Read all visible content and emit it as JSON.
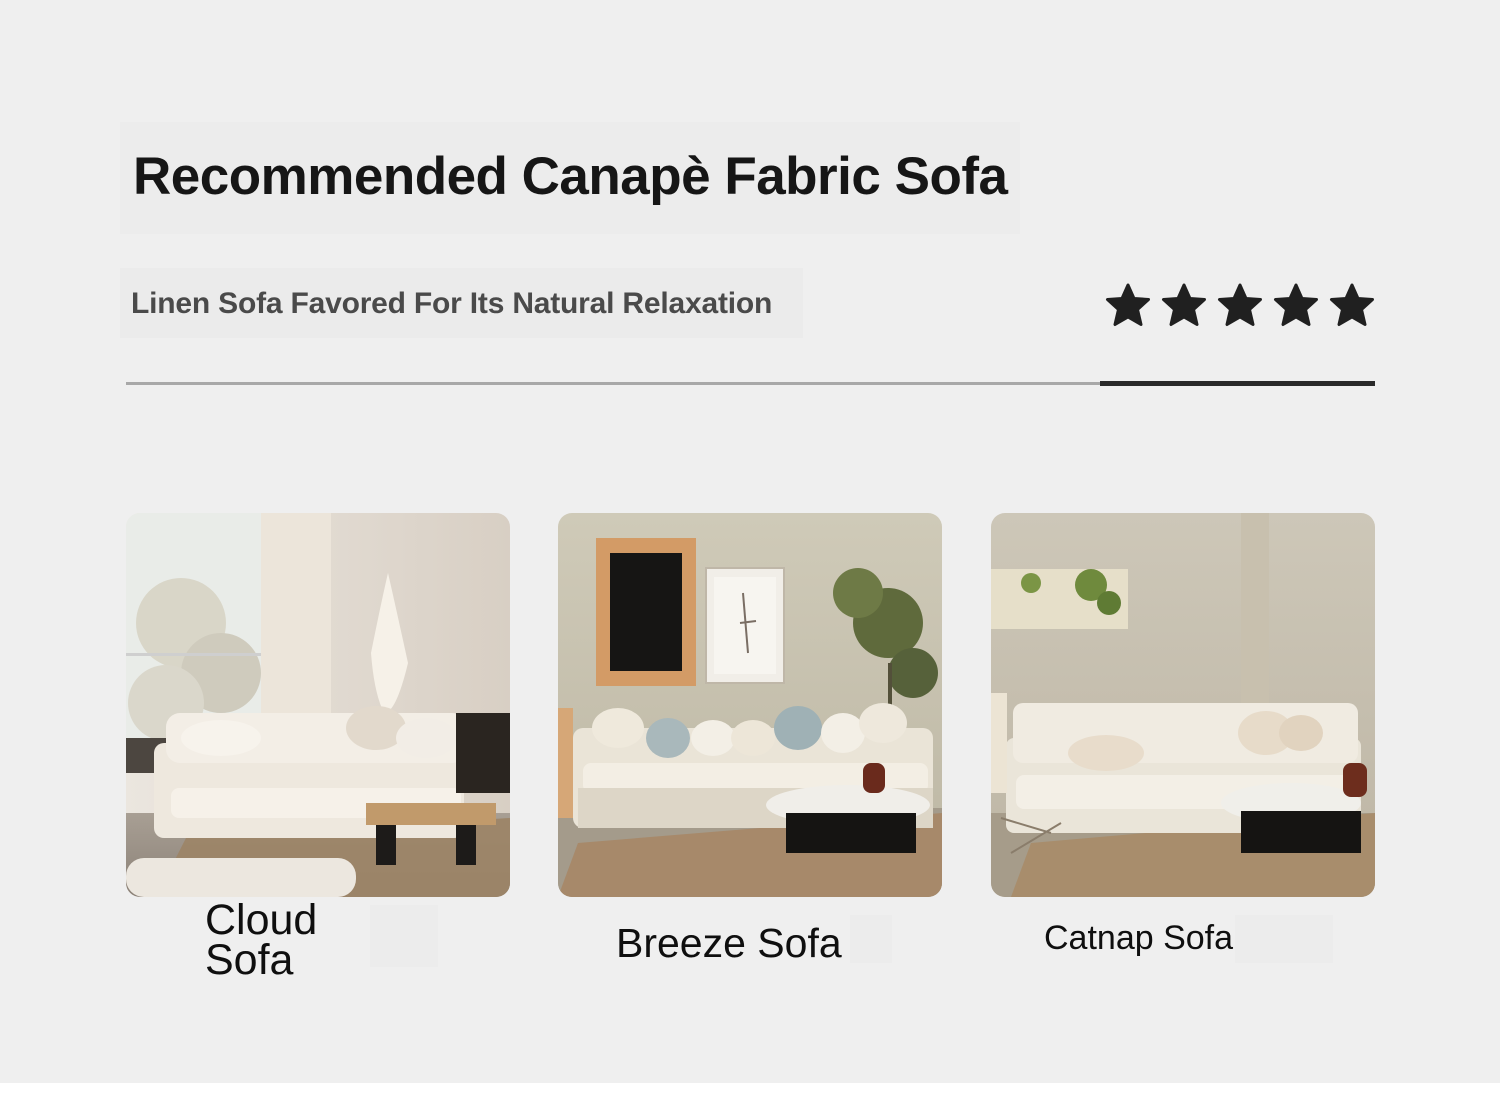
{
  "header": {
    "title": "Recommended Canapè Fabric Sofa",
    "subtitle": "Linen Sofa Favored For Its Natural Relaxation"
  },
  "rating": {
    "stars": 5,
    "max": 5,
    "icon": "star-icon"
  },
  "carousel": {
    "progress": 0.22
  },
  "products": [
    {
      "name": "Cloud Sofa"
    },
    {
      "name": "Breeze Sofa"
    },
    {
      "name": "Catnap Sofa"
    }
  ],
  "colors": {
    "background": "#efefef",
    "title": "#161616",
    "subtitle": "#4a4a4a",
    "star": "#202020",
    "divider": "#a8a8a8",
    "divider_active": "#2a2a2a"
  }
}
